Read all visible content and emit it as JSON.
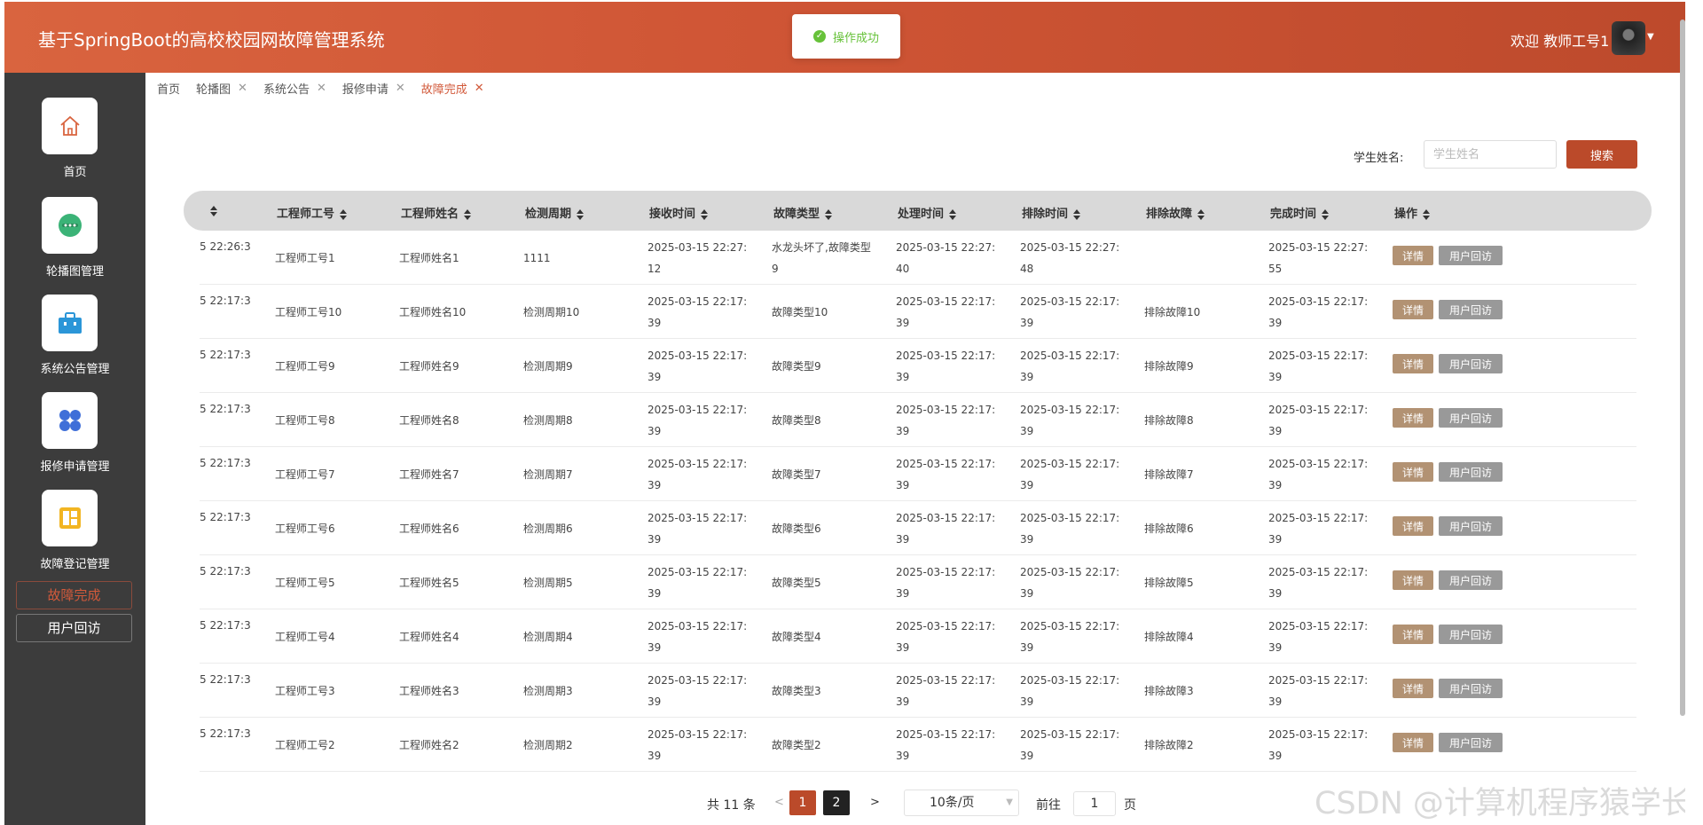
{
  "header": {
    "title": "基于SpringBoot的高校校园网故障管理系统",
    "toast": "操作成功",
    "welcome": "欢迎 教师工号1"
  },
  "sidebar": {
    "menus": [
      {
        "label": "首页",
        "icon": "home-icon"
      },
      {
        "label": "轮播图管理",
        "icon": "carousel-icon"
      },
      {
        "label": "系统公告管理",
        "icon": "briefcase-icon"
      },
      {
        "label": "报修申请管理",
        "icon": "apps-grid-icon"
      },
      {
        "label": "故障登记管理",
        "icon": "layout-icon"
      }
    ],
    "subs": [
      {
        "label": "故障完成",
        "active": true
      },
      {
        "label": "用户回访",
        "active": false
      }
    ]
  },
  "tabs": [
    {
      "label": "首页",
      "closable": false
    },
    {
      "label": "轮播图",
      "closable": true
    },
    {
      "label": "系统公告",
      "closable": true
    },
    {
      "label": "报修申请",
      "closable": true
    },
    {
      "label": "故障完成",
      "closable": true,
      "active": true
    }
  ],
  "search": {
    "label": "学生姓名:",
    "placeholder": "学生姓名",
    "button": "搜索"
  },
  "table": {
    "headers": [
      "",
      "工程师工号",
      "工程师姓名",
      "检测周期",
      "接收时间",
      "故障类型",
      "处理时间",
      "排除时间",
      "排除故障",
      "完成时间",
      "操作"
    ],
    "rows": [
      [
        "5 22:26:3",
        "工程师工号1",
        "工程师姓名1",
        "1111",
        "2025-03-15 22:27:12",
        "水龙头坏了,故障类型9",
        "2025-03-15 22:27:40",
        "2025-03-15 22:27:48",
        "",
        "2025-03-15 22:27:55"
      ],
      [
        "5 22:17:3",
        "工程师工号10",
        "工程师姓名10",
        "检测周期10",
        "2025-03-15 22:17:39",
        "故障类型10",
        "2025-03-15 22:17:39",
        "2025-03-15 22:17:39",
        "排除故障10",
        "2025-03-15 22:17:39"
      ],
      [
        "5 22:17:3",
        "工程师工号9",
        "工程师姓名9",
        "检测周期9",
        "2025-03-15 22:17:39",
        "故障类型9",
        "2025-03-15 22:17:39",
        "2025-03-15 22:17:39",
        "排除故障9",
        "2025-03-15 22:17:39"
      ],
      [
        "5 22:17:3",
        "工程师工号8",
        "工程师姓名8",
        "检测周期8",
        "2025-03-15 22:17:39",
        "故障类型8",
        "2025-03-15 22:17:39",
        "2025-03-15 22:17:39",
        "排除故障8",
        "2025-03-15 22:17:39"
      ],
      [
        "5 22:17:3",
        "工程师工号7",
        "工程师姓名7",
        "检测周期7",
        "2025-03-15 22:17:39",
        "故障类型7",
        "2025-03-15 22:17:39",
        "2025-03-15 22:17:39",
        "排除故障7",
        "2025-03-15 22:17:39"
      ],
      [
        "5 22:17:3",
        "工程师工号6",
        "工程师姓名6",
        "检测周期6",
        "2025-03-15 22:17:39",
        "故障类型6",
        "2025-03-15 22:17:39",
        "2025-03-15 22:17:39",
        "排除故障6",
        "2025-03-15 22:17:39"
      ],
      [
        "5 22:17:3",
        "工程师工号5",
        "工程师姓名5",
        "检测周期5",
        "2025-03-15 22:17:39",
        "故障类型5",
        "2025-03-15 22:17:39",
        "2025-03-15 22:17:39",
        "排除故障5",
        "2025-03-15 22:17:39"
      ],
      [
        "5 22:17:3",
        "工程师工号4",
        "工程师姓名4",
        "检测周期4",
        "2025-03-15 22:17:39",
        "故障类型4",
        "2025-03-15 22:17:39",
        "2025-03-15 22:17:39",
        "排除故障4",
        "2025-03-15 22:17:39"
      ],
      [
        "5 22:17:3",
        "工程师工号3",
        "工程师姓名3",
        "检测周期3",
        "2025-03-15 22:17:39",
        "故障类型3",
        "2025-03-15 22:17:39",
        "2025-03-15 22:17:39",
        "排除故障3",
        "2025-03-15 22:17:39"
      ],
      [
        "5 22:17:3",
        "工程师工号2",
        "工程师姓名2",
        "检测周期2",
        "2025-03-15 22:17:39",
        "故障类型2",
        "2025-03-15 22:17:39",
        "2025-03-15 22:17:39",
        "排除故障2",
        "2025-03-15 22:17:39"
      ]
    ],
    "actions": {
      "detail": "详情",
      "visit": "用户回访"
    }
  },
  "pagination": {
    "total": "共 11 条",
    "prev": "<",
    "pages": [
      "1",
      "2"
    ],
    "current": "1",
    "next": ">",
    "page_size": "10条/页",
    "goto_label": "前往",
    "goto_value": "1",
    "page_suffix": "页"
  },
  "watermark": "CSDN @计算机程序猿学长",
  "colors": {
    "brand": "#cf5535",
    "sidebar_bg": "#3c3c3c",
    "detail_btn": "#b29273",
    "visit_btn": "#999999",
    "page_active": "#bb4a2a",
    "page_other": "#222222"
  }
}
